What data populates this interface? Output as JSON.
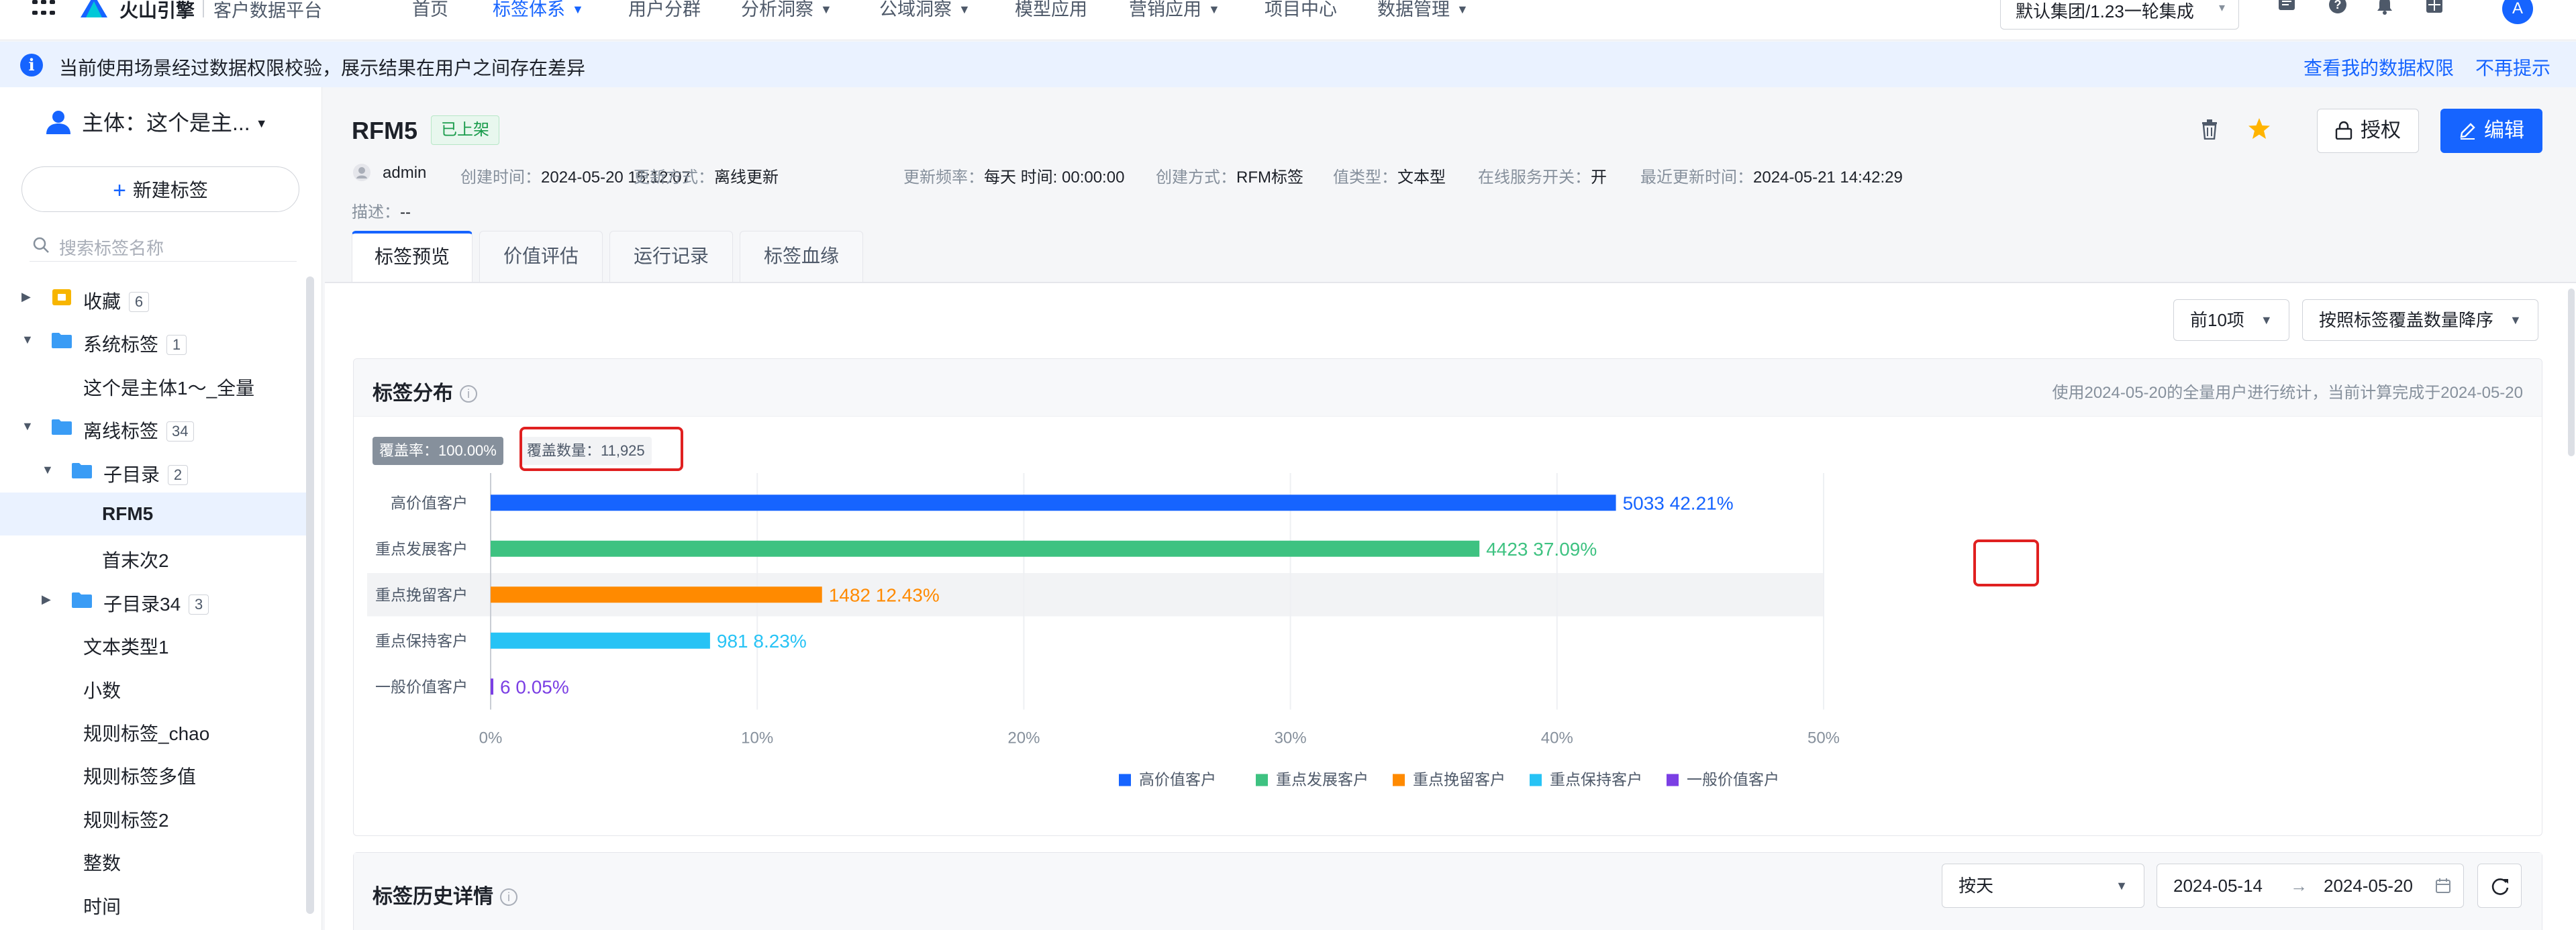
{
  "topnav": {
    "brand": "火山引擎",
    "platform": "客户数据平台",
    "items": [
      {
        "label": "首页",
        "caret": false,
        "active": false
      },
      {
        "label": "标签体系",
        "caret": true,
        "active": true
      },
      {
        "label": "用户分群",
        "caret": false,
        "active": false
      },
      {
        "label": "分析洞察",
        "caret": true,
        "active": false
      },
      {
        "label": "公域洞察",
        "caret": true,
        "active": false
      },
      {
        "label": "模型应用",
        "caret": false,
        "active": false
      },
      {
        "label": "营销应用",
        "caret": true,
        "active": false
      },
      {
        "label": "项目中心",
        "caret": false,
        "active": false
      },
      {
        "label": "数据管理",
        "caret": true,
        "active": false
      }
    ],
    "org": "默认集团/1.23一轮集成",
    "avatar_letter": "A"
  },
  "alert": {
    "message": "当前使用场景经过数据权限校验，展示结果在用户之间存在差异",
    "link_view": "查看我的数据权限",
    "link_dismiss": "不再提示"
  },
  "sidebar": {
    "subject": "主体：这个是主...",
    "new_tag": "新建标签",
    "search_placeholder": "搜索标签名称",
    "tree": [
      {
        "label": "收藏",
        "count": "6",
        "arrow": "right",
        "icon": "favorites",
        "level": 0
      },
      {
        "label": "系统标签",
        "count": "1",
        "arrow": "down",
        "icon": "folder",
        "level": 0
      },
      {
        "label": "这个是主体1～_全量",
        "count": "",
        "arrow": "",
        "icon": "",
        "level": 1
      },
      {
        "label": "离线标签",
        "count": "34",
        "arrow": "down",
        "icon": "folder",
        "level": 0
      },
      {
        "label": "子目录",
        "count": "2",
        "arrow": "down",
        "icon": "folder",
        "level": 1
      },
      {
        "label": "RFM5",
        "count": "",
        "arrow": "",
        "icon": "",
        "level": 2,
        "selected": true
      },
      {
        "label": "首末次2",
        "count": "",
        "arrow": "",
        "icon": "",
        "level": 2
      },
      {
        "label": "子目录34",
        "count": "3",
        "arrow": "right",
        "icon": "folder",
        "level": 1
      },
      {
        "label": "文本类型1",
        "count": "",
        "arrow": "",
        "icon": "",
        "level": 1
      },
      {
        "label": "小数",
        "count": "",
        "arrow": "",
        "icon": "",
        "level": 1
      },
      {
        "label": "规则标签_chao",
        "count": "",
        "arrow": "",
        "icon": "",
        "level": 1
      },
      {
        "label": "规则标签多值",
        "count": "",
        "arrow": "",
        "icon": "",
        "level": 1
      },
      {
        "label": "规则标签2",
        "count": "",
        "arrow": "",
        "icon": "",
        "level": 1
      },
      {
        "label": "整数",
        "count": "",
        "arrow": "",
        "icon": "",
        "level": 1
      },
      {
        "label": "时间",
        "count": "",
        "arrow": "",
        "icon": "",
        "level": 1
      }
    ]
  },
  "detail": {
    "title": "RFM5",
    "status": "已上架",
    "owner": "admin",
    "meta": [
      {
        "key": "创建时间：",
        "value": "2024-05-20 15:12:07"
      },
      {
        "key": "更新方式：",
        "value": "离线更新"
      },
      {
        "key": "更新频率：",
        "value": "每天 时间: 00:00:00"
      },
      {
        "key": "创建方式：",
        "value": "RFM标签"
      },
      {
        "key": "值类型：",
        "value": "文本型"
      },
      {
        "key": "在线服务开关：",
        "value": "开"
      },
      {
        "key": "最近更新时间：",
        "value": "2024-05-21 14:42:29"
      }
    ],
    "desc_key": "描述：",
    "desc_value": "--",
    "auth_label": "授权",
    "edit_label": "编辑",
    "tabs": [
      "标签预览",
      "价值评估",
      "运行记录",
      "标签血缘"
    ]
  },
  "filters": {
    "topn": "前10项",
    "sort": "按照标签覆盖数量降序"
  },
  "distribution": {
    "title": "标签分布",
    "note": "使用2024-05-20的全量用户进行统计，当前计算完成于2024-05-20",
    "coverage_rate": "覆盖率：100.00%",
    "coverage_count": "覆盖数量：11,925"
  },
  "chart_data": {
    "type": "bar",
    "orientation": "horizontal",
    "categories": [
      "高价值客户",
      "重点发展客户",
      "重点挽留客户",
      "重点保持客户",
      "一般价值客户"
    ],
    "values": [
      5033,
      4423,
      1482,
      981,
      6
    ],
    "percent_labels": [
      "42.21%",
      "37.09%",
      "12.43%",
      "8.23%",
      "0.05%"
    ],
    "percents": [
      42.21,
      37.09,
      12.43,
      8.23,
      0.05
    ],
    "colors": [
      "#1664ff",
      "#3ec281",
      "#ff8a00",
      "#27c3f5",
      "#7b3fe4"
    ],
    "x_ticks": [
      "0%",
      "10%",
      "20%",
      "30%",
      "40%",
      "50%"
    ],
    "xlim": [
      0,
      50
    ],
    "highlighted_row": 2,
    "legend": [
      "高价值客户",
      "重点发展客户",
      "重点挽留客户",
      "重点保持客户",
      "一般价值客户"
    ],
    "legend_position": "bottom-center",
    "grid": true
  },
  "history": {
    "title": "标签历史详情",
    "granularity": "按天",
    "date_start": "2024-05-14",
    "date_arrow": "→",
    "date_end": "2024-05-20"
  }
}
